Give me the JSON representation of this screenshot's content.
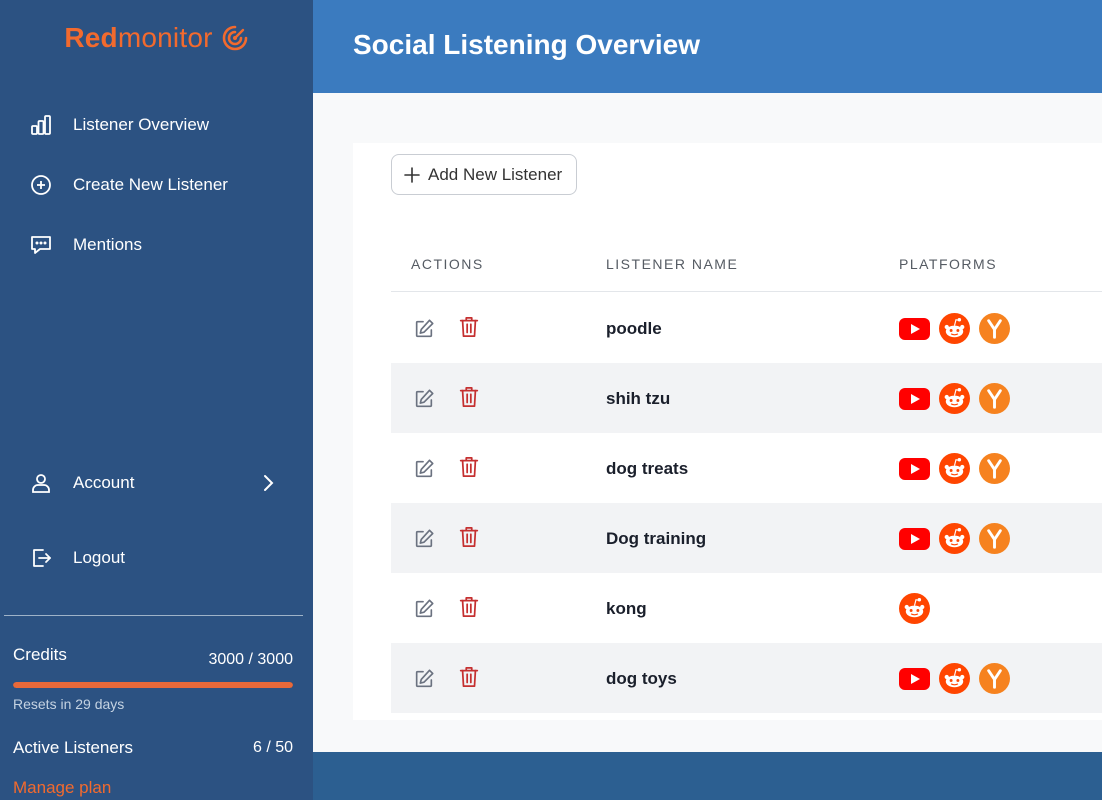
{
  "brand": {
    "part1": "Red",
    "part2": "monitor"
  },
  "sidebar": {
    "items": [
      {
        "label": "Listener Overview",
        "icon": "bar-chart-icon"
      },
      {
        "label": "Create New Listener",
        "icon": "plus-circle-icon"
      },
      {
        "label": "Mentions",
        "icon": "chat-bubble-icon"
      }
    ],
    "account": {
      "label": "Account",
      "icon": "user-icon"
    },
    "logout": {
      "label": "Logout",
      "icon": "logout-icon"
    },
    "credits": {
      "label": "Credits",
      "value": "3000 / 3000",
      "fill_fraction": 1.0,
      "resets": "Resets in 29 days"
    },
    "active": {
      "label": "Active Listeners",
      "value": "6 / 50"
    },
    "manage_plan": "Manage plan"
  },
  "header": {
    "title": "Social Listening Overview"
  },
  "main": {
    "add_button": "Add New Listener",
    "columns": [
      "ACTIONS",
      "LISTENER NAME",
      "PLATFORMS"
    ],
    "rows": [
      {
        "name": "poodle",
        "platforms": [
          "youtube",
          "reddit",
          "ycombinator"
        ]
      },
      {
        "name": "shih tzu",
        "platforms": [
          "youtube",
          "reddit",
          "ycombinator"
        ]
      },
      {
        "name": "dog treats",
        "platforms": [
          "youtube",
          "reddit",
          "ycombinator"
        ]
      },
      {
        "name": "Dog training",
        "platforms": [
          "youtube",
          "reddit",
          "ycombinator"
        ]
      },
      {
        "name": "kong",
        "platforms": [
          "reddit"
        ]
      },
      {
        "name": "dog toys",
        "platforms": [
          "youtube",
          "reddit",
          "ycombinator"
        ]
      }
    ]
  },
  "colors": {
    "sidebar_bg": "#2c5282",
    "header_bg": "#3b7bbf",
    "brand_orange": "#f26a2e",
    "delete_red": "#c53030",
    "youtube_red": "#ff0000",
    "reddit_orange": "#ff4500",
    "yc_orange": "#f6821f"
  }
}
